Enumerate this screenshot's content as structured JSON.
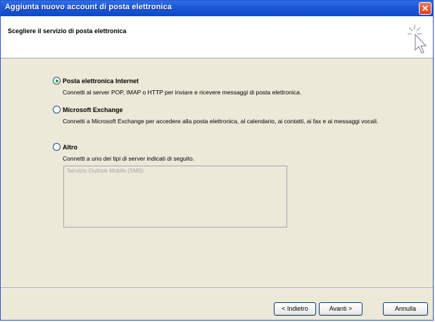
{
  "window": {
    "title": "Aggiunta nuovo account di posta elettronica",
    "close_icon": "close-icon"
  },
  "header": {
    "title": "Scegliere il servizio di posta elettronica",
    "icon": "cursor-sparkle-icon"
  },
  "options": [
    {
      "label": "Posta elettronica Internet",
      "checked": true,
      "description": "Connetti al server POP, IMAP o HTTP per inviare e ricevere messaggi di posta elettronica."
    },
    {
      "label": "Microsoft Exchange",
      "checked": false,
      "description": "Connetti a Microsoft Exchange per accedere alla posta elettronica, al calendario, ai contatti, ai fax e ai messaggi vocali."
    },
    {
      "label": "Altro",
      "checked": false,
      "description": "Connetti a uno dei tipi di server indicati di seguito."
    }
  ],
  "other_list": {
    "items": [
      "Servizio Outlook Mobile (SMS)"
    ]
  },
  "buttons": {
    "back": "< Indietro",
    "next": "Avanti >",
    "cancel": "Annulla"
  }
}
